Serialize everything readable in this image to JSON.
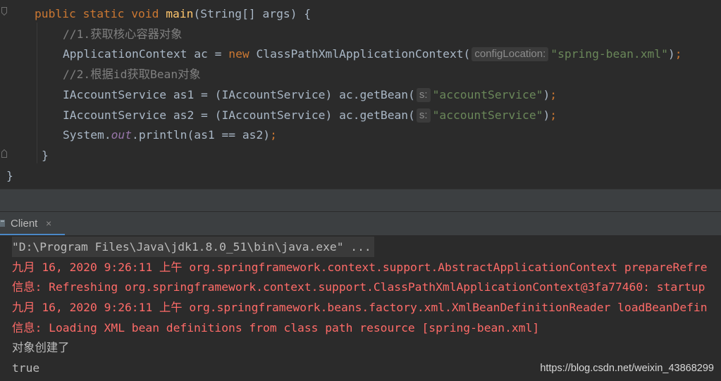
{
  "editor": {
    "lines": {
      "main_sig": {
        "kw": "public static void ",
        "fn": "main",
        "rest": "(String[] args) {"
      },
      "comment1": "//1.获取核心容器对象",
      "ac": {
        "pre": "ApplicationContext ac = ",
        "kw": "new",
        "mid": " ClassPathXmlApplicationContext(",
        "hint": "configLocation:",
        "str": "\"spring-bean.xml\"",
        "post": ")",
        "semi": ";"
      },
      "comment2": "//2.根据id获取Bean对象",
      "as1": {
        "pre": "IAccountService as1 = (IAccountService) ac.getBean(",
        "hint": "s:",
        "str": "\"accountService\"",
        "post": ")",
        "semi": ";"
      },
      "as2": {
        "pre": "IAccountService as2 = (IAccountService) ac.getBean(",
        "hint": "s:",
        "str": "\"accountService\"",
        "post": ")",
        "semi": ";"
      },
      "println": {
        "pre": "System.",
        "field": "out",
        "post": ".println(as1 == as2)",
        "semi": ";"
      },
      "close_method": "}",
      "close_class": "}"
    }
  },
  "run_panel": {
    "tab_label": "Client",
    "tab_close": "×"
  },
  "console": {
    "cmd": "\"D:\\Program Files\\Java\\jdk1.8.0_51\\bin\\java.exe\" ...",
    "log1": "九月 16, 2020 9:26:11 上午 org.springframework.context.support.AbstractApplicationContext prepareRefre",
    "log2": "信息: Refreshing org.springframework.context.support.ClassPathXmlApplicationContext@3fa77460: startup",
    "log3": "九月 16, 2020 9:26:11 上午 org.springframework.beans.factory.xml.XmlBeanDefinitionReader loadBeanDefin",
    "log4": "信息: Loading XML bean definitions from class path resource [spring-bean.xml]",
    "out1": "对象创建了",
    "out2": "true"
  },
  "watermark": "https://blog.csdn.net/weixin_43868299",
  "colors": {
    "background": "#2b2b2b",
    "keyword": "#cc7832",
    "method": "#ffc66d",
    "comment": "#808080",
    "string": "#6a8759",
    "field": "#9876aa",
    "error_text": "#ff6b68",
    "tab_accent": "#4a88c7"
  }
}
